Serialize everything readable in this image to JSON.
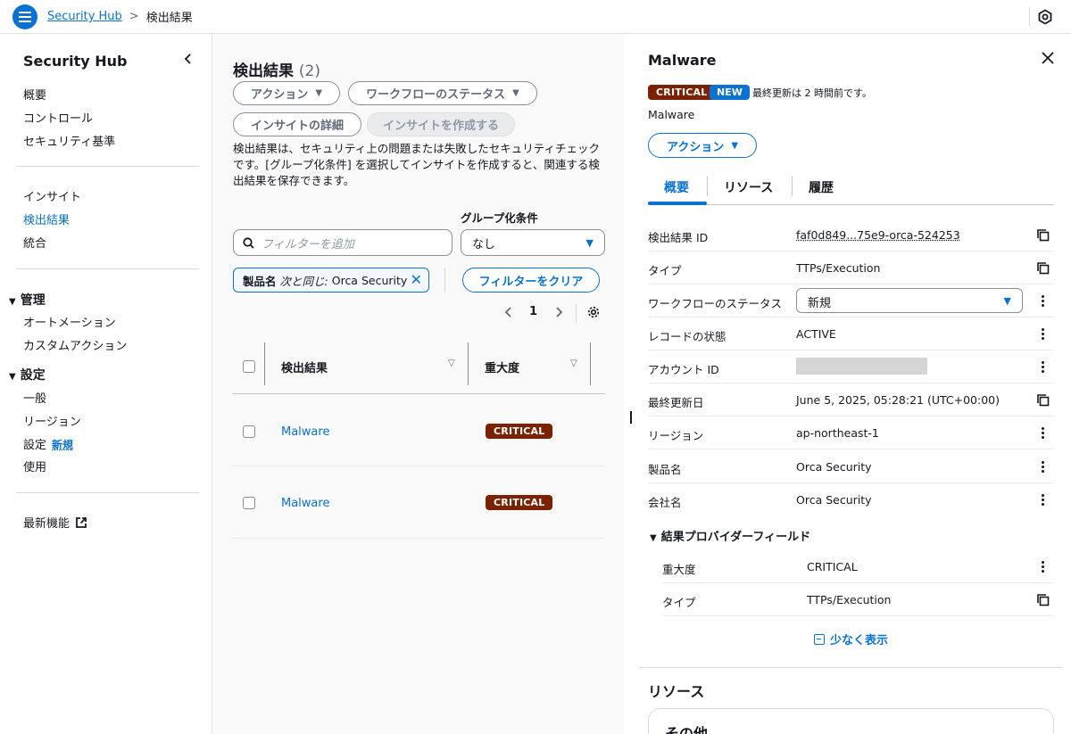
{
  "breadcrumb": {
    "root": "Security Hub",
    "current": "検出結果"
  },
  "sidebar": {
    "title": "Security Hub",
    "items_top": [
      "概要",
      "コントロール",
      "セキュリティ基準"
    ],
    "items_mid": [
      "インサイト",
      "検出結果",
      "統合"
    ],
    "active": "検出結果",
    "group_manage": {
      "label": "管理",
      "items": [
        "オートメーション",
        "カスタムアクション"
      ]
    },
    "group_settings": {
      "label": "設定",
      "items": [
        "一般",
        "リージョン",
        "設定",
        "使用"
      ],
      "new_label": "新規"
    },
    "whats_new": "最新機能"
  },
  "findings": {
    "title": "検出結果",
    "count": "(2)",
    "actions_label": "アクション",
    "workflow_label": "ワークフローのステータス",
    "insight_details_label": "インサイトの詳細",
    "create_insight_label": "インサイトを作成する",
    "description": "検出結果は、セキュリティ上の問題または失敗したセキュリティチェックです。[グループ化条件] を選択してインサイトを作成すると、関連する検出結果を保存できます。",
    "group_by_label": "グループ化条件",
    "group_by_value": "なし",
    "search_placeholder": "フィルターを追加",
    "filter_token": {
      "key": "製品名",
      "operator": "次と同じ:",
      "value": "Orca Security"
    },
    "clear_filters_label": "フィルターをクリア",
    "page": "1",
    "columns": [
      "検出結果",
      "重大度"
    ],
    "rows": [
      {
        "title": "Malware",
        "severity": "CRITICAL"
      },
      {
        "title": "Malware",
        "severity": "CRITICAL"
      }
    ]
  },
  "detail": {
    "title": "Malware",
    "severity": "CRITICAL",
    "new_badge": "NEW",
    "updated": "最終更新は 2 時間前です。",
    "subtitle": "Malware",
    "action_label": "アクション",
    "tabs": [
      "概要",
      "リソース",
      "履歴"
    ],
    "fields": [
      {
        "key": "検出結果 ID",
        "value": "faf0d849...75e9-orca-524253"
      },
      {
        "key": "タイプ",
        "value": "TTPs/Execution"
      },
      {
        "key": "ワークフローのステータス",
        "value": "新規"
      },
      {
        "key": "レコードの状態",
        "value": "ACTIVE"
      },
      {
        "key": "アカウント ID",
        "value": ""
      },
      {
        "key": "最終更新日",
        "value": "June 5, 2025, 05:28:21 (UTC+00:00)"
      },
      {
        "key": "リージョン",
        "value": "ap-northeast-1"
      },
      {
        "key": "製品名",
        "value": "Orca Security"
      },
      {
        "key": "会社名",
        "value": "Orca Security"
      }
    ],
    "provider_section": "結果プロバイダーフィールド",
    "provider_fields": [
      {
        "key": "重大度",
        "value": "CRITICAL"
      },
      {
        "key": "タイプ",
        "value": "TTPs/Execution"
      }
    ],
    "show_less": "少なく表示",
    "resources_title": "リソース",
    "other_label": "その他"
  },
  "colors": {
    "accent": "#0972d3",
    "critical": "#7d2105",
    "text": "#16191f"
  }
}
